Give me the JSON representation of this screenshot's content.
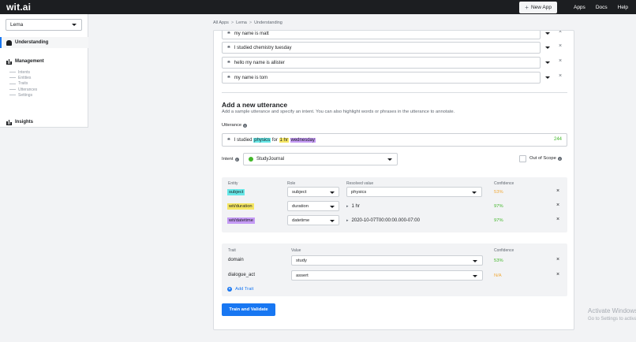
{
  "topbar": {
    "logo": "wit.ai",
    "new_app": "New App",
    "links": [
      "Apps",
      "Docs",
      "Help"
    ]
  },
  "sidebar": {
    "app_name": "Lema",
    "understanding": "Understanding",
    "management": "Management",
    "management_items": [
      "Intents",
      "Entities",
      "Traits",
      "Utterances",
      "Settings"
    ],
    "insights": "Insights"
  },
  "breadcrumb": [
    "All Apps",
    "Lema",
    "Understanding"
  ],
  "utterances": [
    "my name is matt",
    "I studied chemistry tuesday",
    "hello my name is allister",
    "my name is tom"
  ],
  "add_utterance": {
    "title": "Add a new utterance",
    "description": "Add a sample utterance and specify an intent. You can also highlight words or phrases in the utterance to annotate.",
    "utterance_label": "Utterance",
    "utterance_parts": {
      "p1": "I studied ",
      "physics": "physics",
      "p2": " for ",
      "duration": "1 hr",
      "p3": " ",
      "datetime": "wednesday"
    },
    "char_count": "244",
    "intent_label": "Intent",
    "intent_value": "StudyJournal",
    "out_of_scope": "Out of Scope"
  },
  "entities": {
    "headers": {
      "entity": "Entity",
      "role": "Role",
      "resolved": "Resolved value",
      "confidence": "Confidence"
    },
    "rows": [
      {
        "entity": "subject",
        "role": "subject",
        "resolved": "physics",
        "confidence": "53%"
      },
      {
        "entity": "wit/duration",
        "role": "duration",
        "resolved": "1 hr",
        "confidence": "97%"
      },
      {
        "entity": "wit/datetime",
        "role": "datetime",
        "resolved": "2020-10-07T00:00:00.000-07:00",
        "confidence": "97%"
      }
    ]
  },
  "traits": {
    "headers": {
      "trait": "Trait",
      "value": "Value",
      "confidence": "Confidence"
    },
    "rows": [
      {
        "trait": "domain",
        "value": "study",
        "confidence": "53%"
      },
      {
        "trait": "dialogue_act",
        "value": "assert",
        "confidence": "N/A"
      }
    ],
    "add_trait": "Add Trait"
  },
  "train_button": "Train and Validate",
  "watermark": {
    "line1": "Activate Windows",
    "line2": "Go to Settings to activate Windows."
  },
  "colors": {
    "topbar": "#1c1e21",
    "accent": "#1877f2",
    "highlight_subject": "#67e8e8",
    "highlight_duration": "#f5e663",
    "highlight_datetime": "#c59bf5",
    "confidence_high": "#42b72a",
    "confidence_mid": "#f0a93a"
  }
}
